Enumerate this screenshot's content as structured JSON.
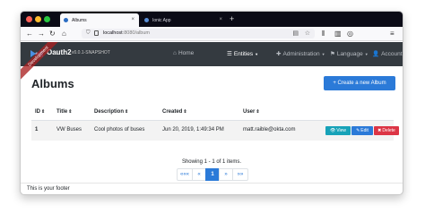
{
  "browser": {
    "tabs": [
      {
        "title": "Albums",
        "active": true
      },
      {
        "title": "Ionic App",
        "active": false
      }
    ],
    "url": {
      "host": "localhost",
      "rest": ":8080/album"
    },
    "icons": {
      "close": "×",
      "new_tab": "+",
      "back": "←",
      "forward": "→",
      "reload": "↻",
      "home": "⌂",
      "shield": "⛉",
      "reader": "▤",
      "star": "☆",
      "library": "⫴",
      "sidebar": "▥",
      "account": "◎",
      "menu": "≡"
    }
  },
  "navbar": {
    "ribbon": "Development",
    "brand": "Oauth2",
    "version": "v0.0.1-SNAPSHOT",
    "items": [
      {
        "label": "Home",
        "icon": "⌂"
      },
      {
        "label": "Entities",
        "icon": "☰"
      },
      {
        "label": "Administration",
        "icon": "✚"
      },
      {
        "label": "Language",
        "icon": "⚑"
      },
      {
        "label": "Account",
        "icon": "👤"
      }
    ],
    "caret": "▼"
  },
  "page": {
    "title": "Albums",
    "create_button": "+ Create a new Album"
  },
  "table": {
    "sort_icon": "⇕",
    "columns": [
      "ID",
      "Title",
      "Description",
      "Created",
      "User"
    ],
    "rows": [
      {
        "id": "1",
        "title": "VW Buses",
        "description": "Cool photos of buses",
        "created": "Jun 20, 2019, 1:49:34 PM",
        "user": "matt.raible@okta.com"
      }
    ],
    "actions": [
      {
        "label": "View",
        "icon": "👁"
      },
      {
        "label": "Edit",
        "icon": "✎"
      },
      {
        "label": "Delete",
        "icon": "✖"
      }
    ]
  },
  "pagination": {
    "summary": "Showing 1 - 1 of 1 items.",
    "first": "«««",
    "prev": "«",
    "current": "1",
    "next": "»",
    "last": "»»"
  },
  "footer": {
    "text": "This is your footer"
  },
  "colors": {
    "navbar_bg": "#343a40",
    "primary": "#2b7ad8",
    "info": "#17a2b8",
    "danger": "#dc3545",
    "ribbon": "#aa2323"
  }
}
